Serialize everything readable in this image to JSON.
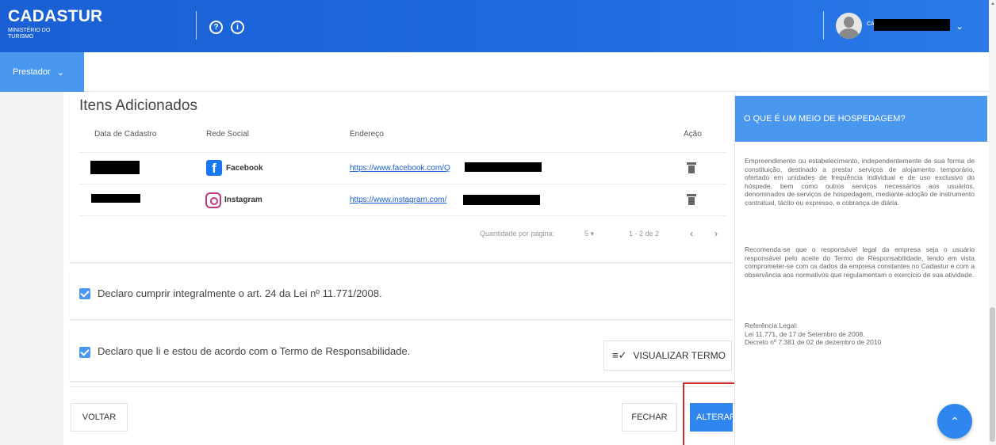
{
  "header": {
    "brand": "CADASTUR",
    "brand_sub": "MINISTÉRIO DO TURISMO",
    "help_icon": "?",
    "info_icon": "i",
    "user_prefix": "CA"
  },
  "subnav": {
    "role_menu": "Prestador"
  },
  "items": {
    "title": "Itens Adicionados",
    "columns": [
      "Data de Cadastro",
      "Rede Social",
      "Endereço",
      "Ação"
    ],
    "rows": [
      {
        "network": "Facebook",
        "address": "https://www.facebook.com/Q"
      },
      {
        "network": "Instagram",
        "address": "https://www.instagram.com/"
      }
    ],
    "pagination": {
      "per_page_label": "Quantidade por página:",
      "per_page": "5 ▾",
      "range": "1 - 2 de 2"
    }
  },
  "declarations": {
    "lei": "Declaro cumprir integralmente o art. 24 da Lei nº 11.771/2008.",
    "termo": "Declaro que li e estou de acordo com o Termo de Responsabilidade.",
    "view_term_button": "VISUALIZAR TERMO"
  },
  "footer": {
    "back": "VOLTAR",
    "close": "FECHAR",
    "alter": "ALTERAR"
  },
  "info_panel": {
    "title": "O QUE É UM MEIO DE HOSPEDAGEM?",
    "paragraph1": "Empreendimento ou estabelecimento, independentemente de sua forma de constituição, destinado a prestar serviços de alojamento temporário, ofertado em unidades de frequência individual e de uso exclusivo do hóspede, bem como outros serviços necessários aos usuários, denominados de serviços de hospedagem, mediante adoção de instrumento contratual, tácito ou expresso, e cobrança de diária.",
    "paragraph2": "Recomenda-se que o responsável legal da empresa seja o usuário responsável pelo aceite do Termo de Responsabilidade, tendo em vista comprometer-se com os dados da empresa constantes no Cadastur e com a observância aos normativos que regulamentam o exercício de sua atividade.",
    "ref_title": "Referência Legal:",
    "ref1": "Lei 11.771, de 17 de Setembro de 2008.",
    "ref2": "Decreto nº 7.381 de 02 de dezembro de 2010"
  },
  "colors": {
    "primary": "#1f6be0",
    "accent": "#4a97f0",
    "highlight": "#d12a2a"
  }
}
